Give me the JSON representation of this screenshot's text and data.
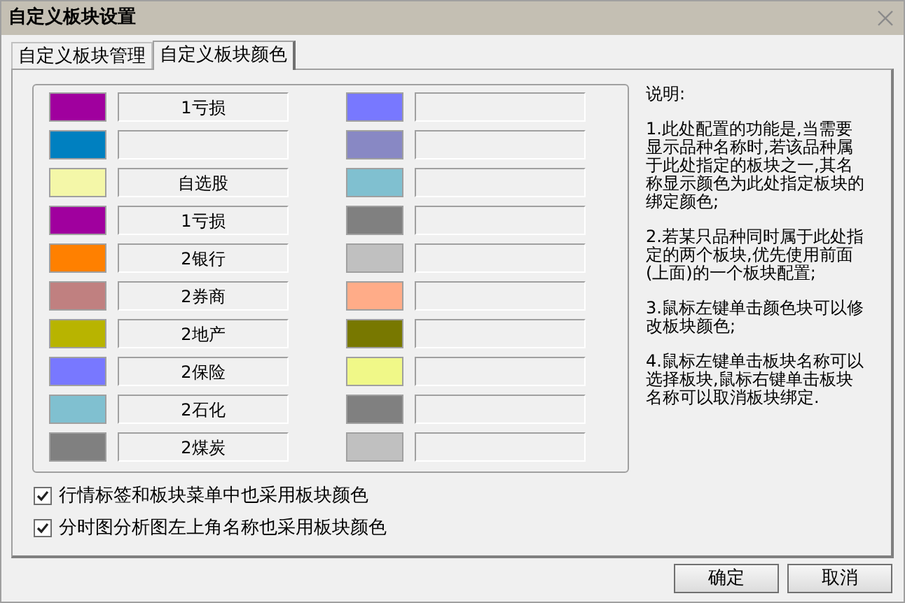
{
  "window": {
    "title": "自定义板块设置"
  },
  "tabs": [
    {
      "label": "自定义板块管理",
      "selected": false
    },
    {
      "label": "自定义板块颜色",
      "selected": true
    }
  ],
  "left_blocks": [
    {
      "color": "#a0009e",
      "label": "1亏损"
    },
    {
      "color": "#0080c0"
    },
    {
      "color": "#f4f7a8",
      "label": "自选股"
    },
    {
      "color": "#a0009e",
      "label": "1亏损"
    },
    {
      "color": "#ff8000",
      "label": "2银行"
    },
    {
      "color": "#c08080",
      "label": "2券商"
    },
    {
      "color": "#b8b400",
      "label": "2地产"
    },
    {
      "color": "#7878ff",
      "label": "2保险"
    },
    {
      "color": "#80c0d0",
      "label": "2石化"
    },
    {
      "color": "#808080",
      "label": "2煤炭"
    }
  ],
  "right_blocks": [
    {
      "color": "#7878ff"
    },
    {
      "color": "#8888c4"
    },
    {
      "color": "#80c0d0"
    },
    {
      "color": "#808080"
    },
    {
      "color": "#c0c0c0"
    },
    {
      "color": "#ffac88"
    },
    {
      "color": "#787800"
    },
    {
      "color": "#f0f888"
    },
    {
      "color": "#808080"
    },
    {
      "color": "#c0c0c0"
    }
  ],
  "help": {
    "title": "说明:",
    "paragraphs": [
      "1.此处配置的功能是,当需要显示品种名称时,若该品种属于此处指定的板块之一,其名称显示颜色为此处指定板块的绑定颜色;",
      "2.若某只品种同时属于此处指定的两个板块,优先使用前面(上面)的一个板块配置;",
      "3.鼠标左键单击颜色块可以修改板块颜色;",
      "4.鼠标左键单击板块名称可以选择板块,鼠标右键单击板块名称可以取消板块绑定."
    ]
  },
  "options": [
    {
      "label": "行情标签和板块菜单中也采用板块颜色",
      "checked": true
    },
    {
      "label": "分时图分析图左上角名称也采用板块颜色",
      "checked": true
    }
  ],
  "buttons": [
    "确定",
    "取消"
  ]
}
